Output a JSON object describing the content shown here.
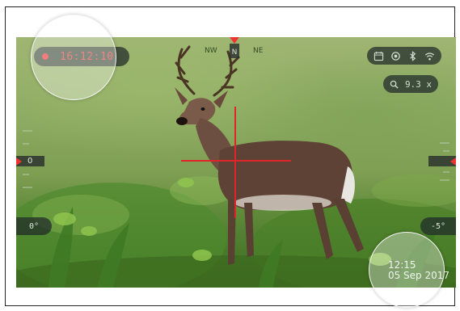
{
  "recording": {
    "time": "16:12:10"
  },
  "status_icons": [
    "calendar-icon",
    "sync-icon",
    "bluetooth-icon",
    "wifi-icon"
  ],
  "zoom": {
    "label": "9.3 x"
  },
  "compass": {
    "nw": "NW",
    "n": "N",
    "ne": "NE"
  },
  "left_marker": {
    "value": "0"
  },
  "tilt": {
    "left": "0°",
    "right": "-5°"
  },
  "datetime": {
    "time": "12:15",
    "date": "05 Sep 2017"
  },
  "colors": {
    "reticle": "#e0242a",
    "record": "#e14747",
    "hud_bg": "#1e2828"
  }
}
